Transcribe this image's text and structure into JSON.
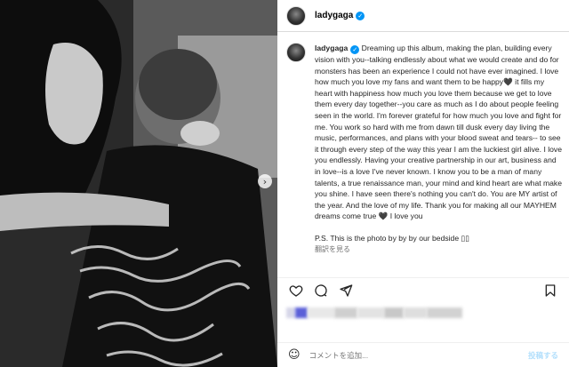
{
  "header": {
    "username": "ladygaga"
  },
  "caption": {
    "username": "ladygaga",
    "text": "Dreaming up this album, making the plan, building every vision with you--talking endlessly about what we would create and do for monsters has been an experience I could not have ever imagined. I love how much you love my fans and want them to be happy🖤 it fills my heart with happiness how much you love them because we get to love them every day together--you care as much as I do about people feeling seen in the world. I'm forever grateful for how much you love and fight for me. You work so hard with me from dawn till dusk every day living the music, performances, and plans with your blood sweat and tears-- to see it through every step of the way this year I am the luckiest girl alive. I love you endlessly. Having your creative partnership in our art, business and in love--is a love I've never known. I know you to be a man of many talents, a true renaissance man, your mind and kind heart are what make you shine. I have seen there's nothing you can't do. You are MY artist of the year. And the love of my life. Thank you for making all our MAYHEM dreams come true 🖤 I love you",
    "ps": "P.S. This is the photo by by by our bedside ▯▯",
    "translate": "翻訳を見る"
  },
  "comment": {
    "placeholder": "コメントを追加...",
    "post_label": "投稿する"
  },
  "icons": {
    "verified": "verified-badge-icon",
    "like": "heart-icon",
    "comment": "comment-icon",
    "share": "paper-plane-icon",
    "save": "bookmark-icon",
    "emoji": "smiley-icon",
    "carousel": "chevron-right-icon"
  },
  "colors": {
    "verified": "#0095f6",
    "post_disabled": "#b2dffc",
    "muted": "#737373"
  }
}
